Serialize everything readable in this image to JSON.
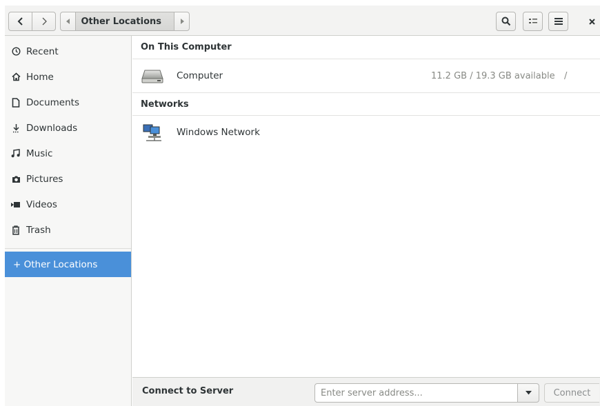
{
  "header": {
    "path_current": "Other Locations"
  },
  "sidebar": {
    "items": [
      {
        "label": "Recent",
        "icon": "clock-icon"
      },
      {
        "label": "Home",
        "icon": "home-icon"
      },
      {
        "label": "Documents",
        "icon": "document-icon"
      },
      {
        "label": "Downloads",
        "icon": "download-icon"
      },
      {
        "label": "Music",
        "icon": "music-icon"
      },
      {
        "label": "Pictures",
        "icon": "camera-icon"
      },
      {
        "label": "Videos",
        "icon": "video-icon"
      },
      {
        "label": "Trash",
        "icon": "trash-icon"
      }
    ],
    "other_locations": {
      "label": "+ Other Locations",
      "icon": "plus-icon"
    }
  },
  "main": {
    "sections": [
      {
        "title": "On This Computer",
        "rows": [
          {
            "name": "Computer",
            "info": "11.2 GB / 19.3 GB available",
            "path": "/",
            "icon": "hard-drive-icon"
          }
        ]
      },
      {
        "title": "Networks",
        "rows": [
          {
            "name": "Windows Network",
            "info": "",
            "path": "",
            "icon": "network-computers-icon"
          }
        ]
      }
    ]
  },
  "actionbar": {
    "label": "Connect to Server",
    "input_placeholder": "Enter server address...",
    "input_value": "",
    "connect_label": "Connect"
  },
  "colors": {
    "selection": "#4a90d9",
    "header_bg": "#f3f3f2",
    "sidebar_bg": "#f7f7f6"
  }
}
